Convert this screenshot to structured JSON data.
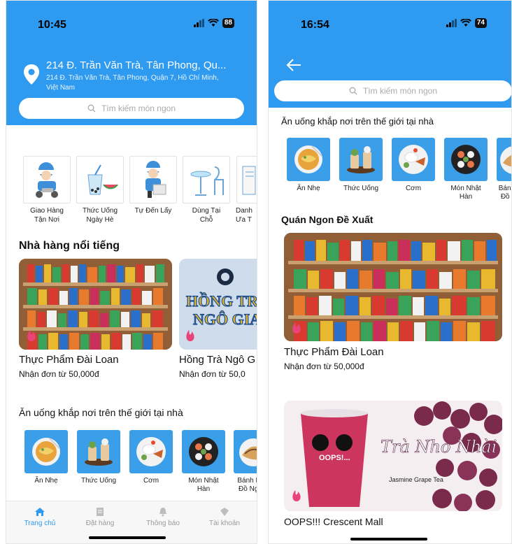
{
  "left": {
    "status": {
      "time": "10:45",
      "battery": "88"
    },
    "address": {
      "line1": "214 Đ. Trần Văn Trà, Tân Phong, Qu...",
      "line2": "214 Đ. Trần Văn Trà, Tân Phong, Quận 7, Hồ Chí Minh, Việt Nam"
    },
    "search": {
      "placeholder": "Tìm kiếm món ngon"
    },
    "categories": [
      {
        "label": "Giao Hàng\nTận Nơi",
        "icon": "delivery-rider-icon"
      },
      {
        "label": "Thức Uống\nNgày Hè",
        "icon": "summer-drink-icon"
      },
      {
        "label": "Tự Đến Lấy",
        "icon": "pickup-courier-icon"
      },
      {
        "label": "Dùng Tại\nChỗ",
        "icon": "table-chairs-icon"
      },
      {
        "label": "Danh\nƯa T",
        "icon": "list-icon"
      }
    ],
    "famous": {
      "title": "Nhà hàng nổi tiếng",
      "cards": [
        {
          "name": "Thực Phẩm Đài Loan",
          "min_order": "Nhận đơn từ 50,000đ"
        },
        {
          "name": "Hồng Trà Ngô G",
          "min_order": "Nhận đơn từ 50,0",
          "banner": "HỒNG TRÀ NGÔ GIA"
        }
      ]
    },
    "world": {
      "title": "Ăn uống khắp nơi trên thế giới tại nhà",
      "items": [
        "Ăn Nhẹ",
        "Thức Uống",
        "Cơm",
        "Món Nhật\nHàn",
        "Bánh Mì\nĐồ Ngọ"
      ]
    },
    "tabs": [
      {
        "label": "Trang chủ",
        "icon": "home-icon",
        "active": true
      },
      {
        "label": "Đặt hàng",
        "icon": "order-icon",
        "active": false
      },
      {
        "label": "Thông báo",
        "icon": "bell-icon",
        "active": false
      },
      {
        "label": "Tài khoản",
        "icon": "account-icon",
        "active": false
      }
    ]
  },
  "right": {
    "status": {
      "time": "16:54",
      "battery": "74"
    },
    "search": {
      "placeholder": "Tìm kiếm món ngon"
    },
    "world": {
      "title": "Ăn uống khắp nơi trên thế giới tại nhà",
      "items": [
        "Ăn Nhẹ",
        "Thức Uống",
        "Cơm",
        "Món Nhật\nHàn",
        "Bánh M\nĐồ Ng"
      ]
    },
    "recommended": {
      "title": "Quán Ngon Đề Xuất",
      "cards": [
        {
          "name": "Thực Phẩm Đài Loan",
          "min_order": "Nhận đơn từ 50,000đ"
        },
        {
          "name": "OOPS!!! Crescent Mall",
          "banner_script": "Trà Nho Nhài",
          "banner_sub": "Jasmine Grape Tea",
          "brand": "OOPS!..."
        }
      ]
    }
  },
  "colors": {
    "primary": "#2f9bf0",
    "tile": "#3a9ee8",
    "pink": "#e8447a"
  }
}
